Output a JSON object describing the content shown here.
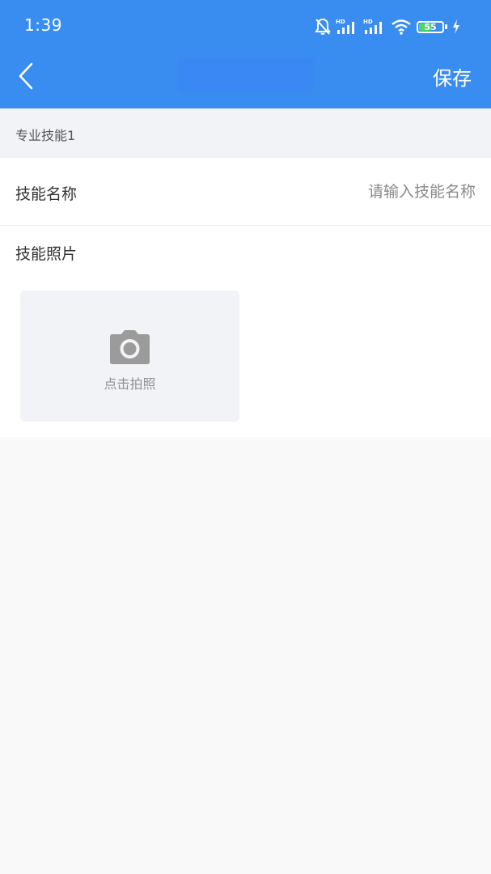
{
  "status_bar": {
    "time": "1:39",
    "battery_level": "55",
    "battery_fraction": 0.55,
    "battery_color": "#4cd964",
    "icons": [
      "mute-bell-icon",
      "hd-signal-icon",
      "hd-signal-icon",
      "wifi-icon",
      "battery-icon",
      "charging-bolt-icon"
    ]
  },
  "nav": {
    "back_icon": "chevron-left-icon",
    "title": "",
    "save_label": "保存",
    "background_color": "#3a8df0"
  },
  "section": {
    "title": "专业技能1"
  },
  "form": {
    "name_label": "技能名称",
    "name_value": "",
    "name_placeholder": "请输入技能名称",
    "photo_label": "技能照片",
    "photo_button_label": "点击拍照",
    "photo_icon": "camera-icon"
  }
}
